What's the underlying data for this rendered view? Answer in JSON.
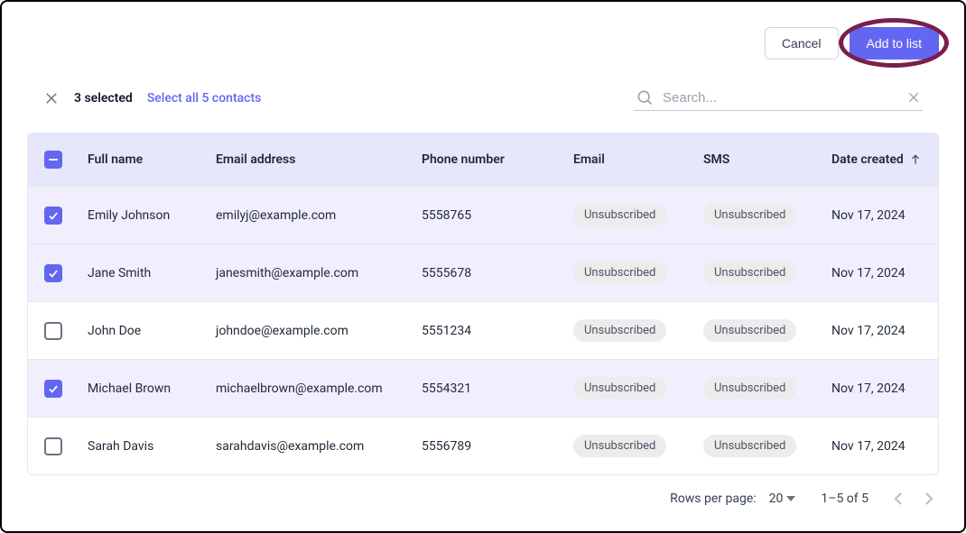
{
  "actions": {
    "cancel": "Cancel",
    "add_to_list": "Add to list"
  },
  "selection": {
    "selected_count_label": "3 selected",
    "select_all_label": "Select all 5 contacts"
  },
  "search": {
    "placeholder": "Search..."
  },
  "columns": {
    "full_name": "Full name",
    "email_address": "Email address",
    "phone_number": "Phone number",
    "email": "Email",
    "sms": "SMS",
    "date_created": "Date created"
  },
  "rows": [
    {
      "selected": true,
      "name": "Emily Johnson",
      "email": "emilyj@example.com",
      "phone": "5558765",
      "email_status": "Unsubscribed",
      "sms_status": "Unsubscribed",
      "date": "Nov 17, 2024"
    },
    {
      "selected": true,
      "name": "Jane Smith",
      "email": "janesmith@example.com",
      "phone": "5555678",
      "email_status": "Unsubscribed",
      "sms_status": "Unsubscribed",
      "date": "Nov 17, 2024"
    },
    {
      "selected": false,
      "name": "John Doe",
      "email": "johndoe@example.com",
      "phone": "5551234",
      "email_status": "Unsubscribed",
      "sms_status": "Unsubscribed",
      "date": "Nov 17, 2024"
    },
    {
      "selected": true,
      "name": "Michael Brown",
      "email": "michaelbrown@example.com",
      "phone": "5554321",
      "email_status": "Unsubscribed",
      "sms_status": "Unsubscribed",
      "date": "Nov 17, 2024"
    },
    {
      "selected": false,
      "name": "Sarah Davis",
      "email": "sarahdavis@example.com",
      "phone": "5556789",
      "email_status": "Unsubscribed",
      "sms_status": "Unsubscribed",
      "date": "Nov 17, 2024"
    }
  ],
  "pagination": {
    "rows_per_page_label": "Rows per page:",
    "page_size": "20",
    "range_label": "1–5 of 5"
  }
}
